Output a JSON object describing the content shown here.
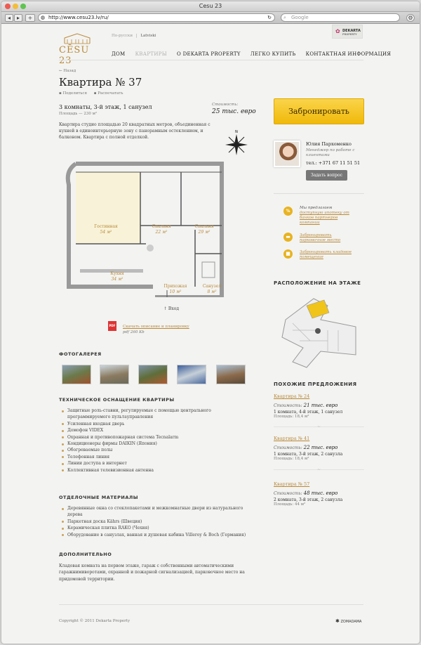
{
  "browser": {
    "title": "Cesu 23",
    "url": "http://www.cesu23.lv/ru/",
    "search_placeholder": "Google"
  },
  "header": {
    "logo_text": "CĒSU 23",
    "lang_current": "По-русски",
    "lang_other": "Latviski",
    "partner_logo": "DEKARTA",
    "partner_sub": "PROPERTY",
    "nav": [
      "ДОМ",
      "КВАРТИРЫ",
      "О DEKARTA PROPERTY",
      "ЛЕГКО КУПИТЬ",
      "КОНТАКТНАЯ ИНФОРМАЦИЯ"
    ]
  },
  "apartment": {
    "back": "← Назад",
    "title": "Квартира № 37",
    "share": "Поделиться",
    "print": "Распечатать",
    "summary": "3 комнаты, 3-й этаж, 1 санузел",
    "area_label": "Площадь — 230 м²",
    "price_label": "Стоимость:",
    "price": "25 тыс. евро",
    "description": "Квартира студио площадью 20 квадратных метров, объединенная с кухней в единоинтерьерную зону с панорамным остеклением, и балконом. Квартира с полной отделкой.",
    "rooms": [
      {
        "name": "Гостинная",
        "area": "54 м²"
      },
      {
        "name": "Спальня",
        "area": "22 м²"
      },
      {
        "name": "Спальня",
        "area": "29 м²"
      },
      {
        "name": "Кухня",
        "area": "34 м²"
      },
      {
        "name": "Прихожая",
        "area": "10 м²"
      },
      {
        "name": "Санузел",
        "area": "8 м²"
      }
    ],
    "entrance": "↑ Вход",
    "download_link": "Скачать описание и планировку",
    "download_meta": "pdf 260 Kb"
  },
  "gallery": {
    "title": "ФОТОГАЛЕРЕЯ"
  },
  "tech": {
    "title": "ТЕХНИЧЕСКОЕ ОСНАЩЕНИЕ КВАРТИРЫ",
    "items": [
      "Защитные роль-ставни, регулируемые с помощью центрального программируемого пультауправления",
      "Усиленная входная дверь",
      "Домофон VIDEX",
      "Охранная и противопожарная система Tecnalarm",
      "Кондиционеры фирмы DAIKIN (Япония)",
      "Обогреваемые полы",
      "Телефонная линия",
      "Линии доступа в интернет",
      "Коллективная телевизионная антенна"
    ]
  },
  "finish": {
    "title": "ОТДЕЛОЧНЫЕ МАТЕРИАЛЫ",
    "items": [
      "Деревянные окна со стеклопакетами и межкомнатные двери из натурального дерева",
      "Паркетная доска Kährs (Швеция)",
      "Керамическая плитка RAKO (Чехия)",
      "Оборудование в санузлах, ванная и душевая кабина Villeroy & Boch (Германия)"
    ]
  },
  "extra": {
    "title": "ДОПОЛНИТЕЛЬНО",
    "text": "Кладовая комната на первом этаже, гараж с собственными автоматическими гаражнимиворотами, охранной и пожарной сигнализацией, парковочное место на придомовой территории."
  },
  "sidebar": {
    "book_button": "Забронировать",
    "manager_name": "Юлия Пархоменко",
    "manager_role": "Менеджер по работе с клиентами",
    "manager_phone": "тел.: +371 67 11 51 51",
    "ask_button": "Задать вопрос",
    "promo1_pre": "Мы предлагаем",
    "promo1_link": "доступную ипотеку от банков партнеров компании",
    "promo2_link": "Забронировать парковочное место",
    "promo3_link": "Забронировать кладовое помещение",
    "floor_title": "РАСПОЛОЖЕНИЕ НА ЭТАЖЕ",
    "similar_title": "ПОХОЖИЕ ПРЕДЛОЖЕНИЯ",
    "offers": [
      {
        "title": "Квартира № 24",
        "price_label": "Стоимость:",
        "price": "21 тыс. евро",
        "details": "1 комната, 4-й этаж, 1 санузел",
        "area": "Площадь: 18,4 м²"
      },
      {
        "title": "Квартира № 41",
        "price_label": "Стоимость:",
        "price": "22 тыс. евро",
        "details": "1 комната, 3-й этаж, 2 санузла",
        "area": "Площадь: 18,4 м²"
      },
      {
        "title": "Квартира № 57",
        "price_label": "Стоимость:",
        "price": "48 тыс. евро",
        "details": "2 комната, 3-й этаж, 2 санузла",
        "area": "Площадь: 44 м²"
      }
    ]
  },
  "footer": {
    "copyright": "Copyright © 2011 Dekarta Property",
    "credit": "ZOMADAMA"
  },
  "colors": {
    "accent": "#b8893a",
    "button": "#f5c518",
    "room_highlight": "#f8f3d8"
  }
}
